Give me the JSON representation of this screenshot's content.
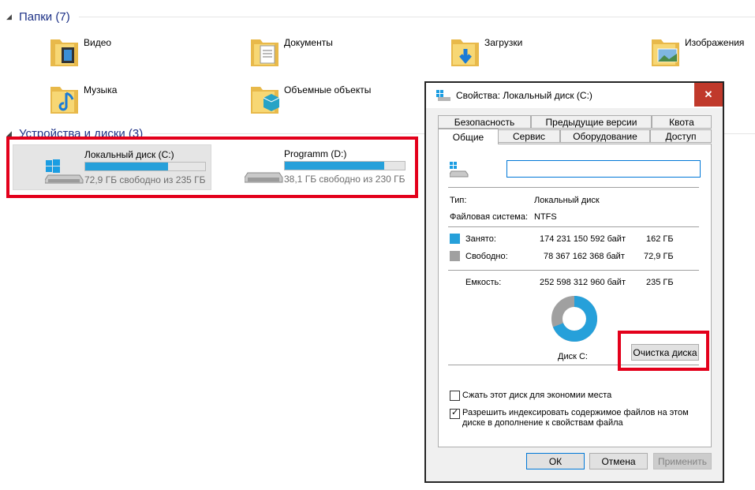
{
  "folders_section": {
    "title": "Папки (7)"
  },
  "folders": [
    {
      "name": "Видео",
      "icon": "video-folder-icon"
    },
    {
      "name": "Документы",
      "icon": "documents-folder-icon"
    },
    {
      "name": "Загрузки",
      "icon": "downloads-folder-icon"
    },
    {
      "name": "Изображения",
      "icon": "pictures-folder-icon"
    },
    {
      "name": "Музыка",
      "icon": "music-folder-icon"
    },
    {
      "name": "Объемные объекты",
      "icon": "3d-objects-folder-icon"
    }
  ],
  "devices_section": {
    "title": "Устройства и диски (3)"
  },
  "drives": [
    {
      "name": "Локальный диск (C:)",
      "free_text": "72,9 ГБ свободно из 235 ГБ",
      "used_fraction": 0.69
    },
    {
      "name": "Programm (D:)",
      "free_text": "38,1 ГБ свободно из 230 ГБ",
      "used_fraction": 0.83
    }
  ],
  "dialog": {
    "title": "Свойства: Локальный диск (C:)",
    "close": "✕",
    "tabs_row1": [
      "Безопасность",
      "Предыдущие версии",
      "Квота"
    ],
    "tabs_row2": [
      "Общие",
      "Сервис",
      "Оборудование",
      "Доступ"
    ],
    "name_value": "",
    "type_label": "Тип:",
    "type_value": "Локальный диск",
    "fs_label": "Файловая система:",
    "fs_value": "NTFS",
    "used_label": "Занято:",
    "used_bytes": "174 231 150 592 байт",
    "used_gb": "162 ГБ",
    "free_label": "Свободно:",
    "free_bytes": "78 367 162 368 байт",
    "free_gb": "72,9 ГБ",
    "capacity_label": "Емкость:",
    "capacity_bytes": "252 598 312 960 байт",
    "capacity_gb": "235 ГБ",
    "disk_label": "Диск C:",
    "cleanup_button": "Очистка диска",
    "compress_label": "Сжать этот диск для экономии места",
    "index_label_line1": "Разрешить индексировать содержимое файлов на этом",
    "index_label_line2": "диске в дополнение к свойствам файла",
    "ok": "ОК",
    "cancel": "Отмена",
    "apply": "Применить",
    "used_fraction": 0.69
  },
  "colors": {
    "used": "#26a0da",
    "free": "#a0a0a0",
    "highlight": "#e3001b",
    "header": "#1e3287"
  }
}
